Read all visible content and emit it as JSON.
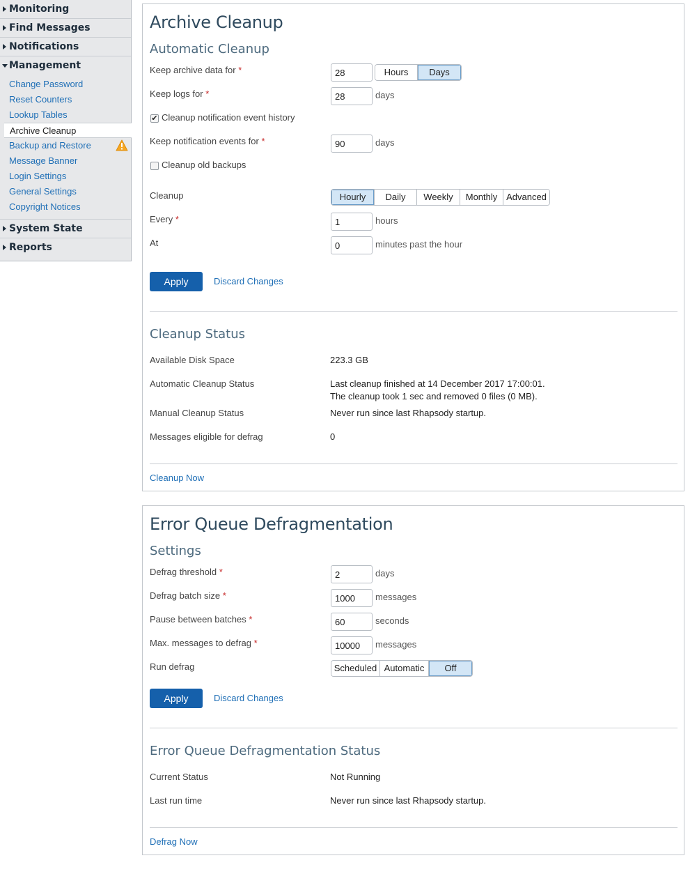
{
  "sidebar": {
    "monitoring": "Monitoring",
    "find_messages": "Find Messages",
    "notifications": "Notifications",
    "management": "Management",
    "management_items": [
      "Change Password",
      "Reset Counters",
      "Lookup Tables",
      "Archive Cleanup",
      "Backup and Restore",
      "Message Banner",
      "Login Settings",
      "General Settings",
      "Copyright Notices"
    ],
    "system_state": "System State",
    "reports": "Reports",
    "warning_icon": "warning-icon"
  },
  "archive": {
    "title": "Archive Cleanup",
    "auto_title": "Automatic Cleanup",
    "keep_archive_label": "Keep archive data for",
    "keep_archive_value": "28",
    "keep_archive_unit_options": [
      "Hours",
      "Days"
    ],
    "keep_archive_unit_selected": "Days",
    "keep_logs_label": "Keep logs for",
    "keep_logs_value": "28",
    "keep_logs_unit": "days",
    "cleanup_history_label": "Cleanup notification event history",
    "cleanup_history_checked": true,
    "keep_events_label": "Keep notification events for",
    "keep_events_value": "90",
    "keep_events_unit": "days",
    "cleanup_backups_label": "Cleanup old backups",
    "cleanup_backups_checked": false,
    "cleanup_label": "Cleanup",
    "cleanup_options": [
      "Hourly",
      "Daily",
      "Weekly",
      "Monthly",
      "Advanced"
    ],
    "cleanup_selected": "Hourly",
    "every_label": "Every",
    "every_value": "1",
    "every_unit": "hours",
    "at_label": "At",
    "at_value": "0",
    "at_unit": "minutes past the hour",
    "apply_label": "Apply",
    "discard_label": "Discard Changes",
    "status_title": "Cleanup Status",
    "disk_label": "Available Disk Space",
    "disk_value": "223.3 GB",
    "auto_status_label": "Automatic Cleanup Status",
    "auto_status_line1": "Last cleanup finished at 14 December 2017 17:00:01.",
    "auto_status_line2": "The cleanup took 1 sec and removed 0 files (0 MB).",
    "manual_status_label": "Manual Cleanup Status",
    "manual_status_value": "Never run since last Rhapsody startup.",
    "defrag_eligible_label": "Messages eligible for defrag",
    "defrag_eligible_value": "0",
    "cleanup_now_label": "Cleanup Now"
  },
  "defrag": {
    "title": "Error Queue Defragmentation",
    "settings_title": "Settings",
    "threshold_label": "Defrag threshold",
    "threshold_value": "2",
    "threshold_unit": "days",
    "batch_label": "Defrag batch size",
    "batch_value": "1000",
    "batch_unit": "messages",
    "pause_label": "Pause between batches",
    "pause_value": "60",
    "pause_unit": "seconds",
    "max_label": "Max. messages to defrag",
    "max_value": "10000",
    "max_unit": "messages",
    "run_label": "Run defrag",
    "run_options": [
      "Scheduled",
      "Automatic",
      "Off"
    ],
    "run_selected": "Off",
    "apply_label": "Apply",
    "discard_label": "Discard Changes",
    "status_title": "Error Queue Defragmentation Status",
    "current_label": "Current Status",
    "current_value": "Not Running",
    "last_run_label": "Last run time",
    "last_run_value": "Never run since last Rhapsody startup.",
    "defrag_now_label": "Defrag Now"
  },
  "colors": {
    "accent": "#1560ab",
    "link": "#1f6fb6",
    "selected_segment": "#d3e6f6",
    "required": "#c62828",
    "warning": "#f5a623"
  }
}
